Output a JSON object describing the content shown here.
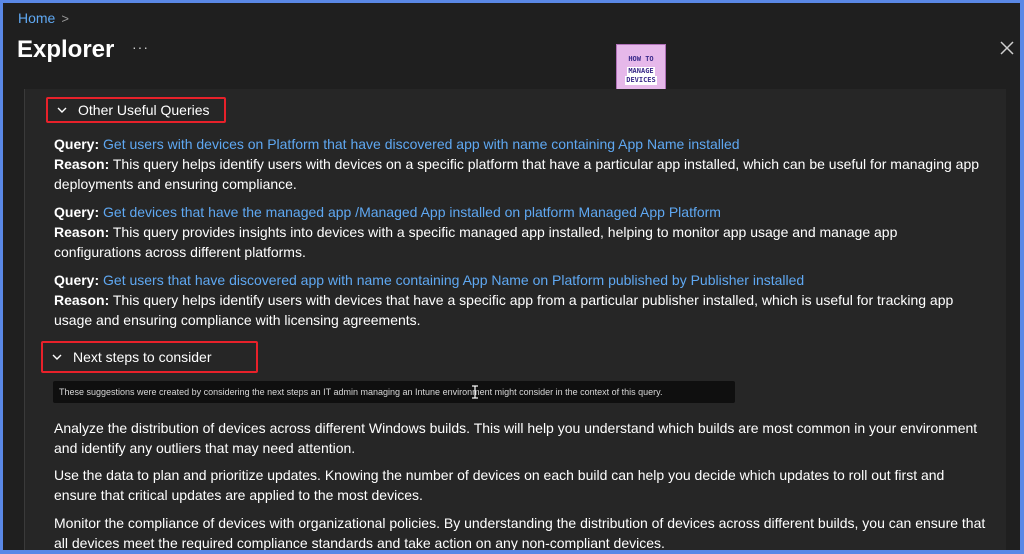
{
  "breadcrumb": {
    "home": "Home",
    "separator": ">"
  },
  "header": {
    "title": "Explorer",
    "more": "···"
  },
  "logo": {
    "line1": "HOW TO",
    "line2": "MANAGE",
    "line3": "DEVICES"
  },
  "sections": {
    "queries": {
      "title": "Other Useful Queries",
      "items": [
        {
          "query_label": "Query:",
          "query": "Get users with devices on Platform that have discovered app with name containing App Name installed",
          "reason_label": "Reason:",
          "reason": "This query helps identify users with devices on a specific platform that have a particular app installed, which can be useful for managing app deployments and ensuring compliance."
        },
        {
          "query_label": "Query:",
          "query": "Get devices that have the managed app /Managed App installed on platform Managed App Platform",
          "reason_label": "Reason:",
          "reason": "This query provides insights into devices with a specific managed app installed, helping to monitor app usage and manage app configurations across different platforms."
        },
        {
          "query_label": "Query:",
          "query": "Get users that have discovered app with name containing App Name on Platform published by Publisher installed",
          "reason_label": "Reason:",
          "reason": "This query helps identify users with devices that have a specific app from a particular publisher installed, which is useful for tracking app usage and ensuring compliance with licensing agreements."
        }
      ]
    },
    "next_steps": {
      "title": "Next steps to consider",
      "tooltip": "These suggestions were created by considering the next steps an IT admin managing an Intune environment might consider in the context of this query.",
      "items": [
        "Analyze the distribution of devices across different Windows builds. This will help you understand which builds are most common in your environment and identify any outliers that may need attention.",
        "Use the data to plan and prioritize updates. Knowing the number of devices on each build can help you decide which updates to roll out first and ensure that critical updates are applied to the most devices.",
        "Monitor the compliance of devices with organizational policies. By understanding the distribution of devices across different builds, you can ensure that all devices meet the required compliance standards and take action on any non-compliant devices."
      ]
    }
  }
}
